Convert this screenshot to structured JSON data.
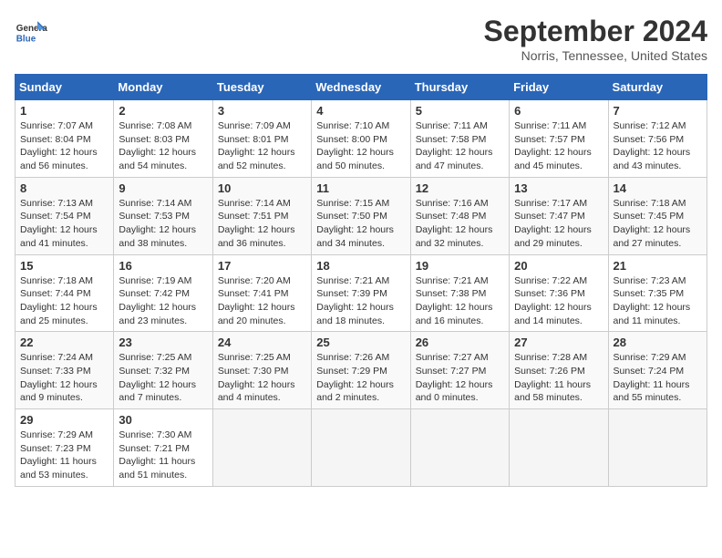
{
  "header": {
    "logo_line1": "General",
    "logo_line2": "Blue",
    "title": "September 2024",
    "subtitle": "Norris, Tennessee, United States"
  },
  "days_of_week": [
    "Sunday",
    "Monday",
    "Tuesday",
    "Wednesday",
    "Thursday",
    "Friday",
    "Saturday"
  ],
  "weeks": [
    [
      {
        "day": 1,
        "sunrise": "7:07 AM",
        "sunset": "8:04 PM",
        "daylight": "12 hours and 56 minutes."
      },
      {
        "day": 2,
        "sunrise": "7:08 AM",
        "sunset": "8:03 PM",
        "daylight": "12 hours and 54 minutes."
      },
      {
        "day": 3,
        "sunrise": "7:09 AM",
        "sunset": "8:01 PM",
        "daylight": "12 hours and 52 minutes."
      },
      {
        "day": 4,
        "sunrise": "7:10 AM",
        "sunset": "8:00 PM",
        "daylight": "12 hours and 50 minutes."
      },
      {
        "day": 5,
        "sunrise": "7:11 AM",
        "sunset": "7:58 PM",
        "daylight": "12 hours and 47 minutes."
      },
      {
        "day": 6,
        "sunrise": "7:11 AM",
        "sunset": "7:57 PM",
        "daylight": "12 hours and 45 minutes."
      },
      {
        "day": 7,
        "sunrise": "7:12 AM",
        "sunset": "7:56 PM",
        "daylight": "12 hours and 43 minutes."
      }
    ],
    [
      {
        "day": 8,
        "sunrise": "7:13 AM",
        "sunset": "7:54 PM",
        "daylight": "12 hours and 41 minutes."
      },
      {
        "day": 9,
        "sunrise": "7:14 AM",
        "sunset": "7:53 PM",
        "daylight": "12 hours and 38 minutes."
      },
      {
        "day": 10,
        "sunrise": "7:14 AM",
        "sunset": "7:51 PM",
        "daylight": "12 hours and 36 minutes."
      },
      {
        "day": 11,
        "sunrise": "7:15 AM",
        "sunset": "7:50 PM",
        "daylight": "12 hours and 34 minutes."
      },
      {
        "day": 12,
        "sunrise": "7:16 AM",
        "sunset": "7:48 PM",
        "daylight": "12 hours and 32 minutes."
      },
      {
        "day": 13,
        "sunrise": "7:17 AM",
        "sunset": "7:47 PM",
        "daylight": "12 hours and 29 minutes."
      },
      {
        "day": 14,
        "sunrise": "7:18 AM",
        "sunset": "7:45 PM",
        "daylight": "12 hours and 27 minutes."
      }
    ],
    [
      {
        "day": 15,
        "sunrise": "7:18 AM",
        "sunset": "7:44 PM",
        "daylight": "12 hours and 25 minutes."
      },
      {
        "day": 16,
        "sunrise": "7:19 AM",
        "sunset": "7:42 PM",
        "daylight": "12 hours and 23 minutes."
      },
      {
        "day": 17,
        "sunrise": "7:20 AM",
        "sunset": "7:41 PM",
        "daylight": "12 hours and 20 minutes."
      },
      {
        "day": 18,
        "sunrise": "7:21 AM",
        "sunset": "7:39 PM",
        "daylight": "12 hours and 18 minutes."
      },
      {
        "day": 19,
        "sunrise": "7:21 AM",
        "sunset": "7:38 PM",
        "daylight": "12 hours and 16 minutes."
      },
      {
        "day": 20,
        "sunrise": "7:22 AM",
        "sunset": "7:36 PM",
        "daylight": "12 hours and 14 minutes."
      },
      {
        "day": 21,
        "sunrise": "7:23 AM",
        "sunset": "7:35 PM",
        "daylight": "12 hours and 11 minutes."
      }
    ],
    [
      {
        "day": 22,
        "sunrise": "7:24 AM",
        "sunset": "7:33 PM",
        "daylight": "12 hours and 9 minutes."
      },
      {
        "day": 23,
        "sunrise": "7:25 AM",
        "sunset": "7:32 PM",
        "daylight": "12 hours and 7 minutes."
      },
      {
        "day": 24,
        "sunrise": "7:25 AM",
        "sunset": "7:30 PM",
        "daylight": "12 hours and 4 minutes."
      },
      {
        "day": 25,
        "sunrise": "7:26 AM",
        "sunset": "7:29 PM",
        "daylight": "12 hours and 2 minutes."
      },
      {
        "day": 26,
        "sunrise": "7:27 AM",
        "sunset": "7:27 PM",
        "daylight": "12 hours and 0 minutes."
      },
      {
        "day": 27,
        "sunrise": "7:28 AM",
        "sunset": "7:26 PM",
        "daylight": "11 hours and 58 minutes."
      },
      {
        "day": 28,
        "sunrise": "7:29 AM",
        "sunset": "7:24 PM",
        "daylight": "11 hours and 55 minutes."
      }
    ],
    [
      {
        "day": 29,
        "sunrise": "7:29 AM",
        "sunset": "7:23 PM",
        "daylight": "11 hours and 53 minutes."
      },
      {
        "day": 30,
        "sunrise": "7:30 AM",
        "sunset": "7:21 PM",
        "daylight": "11 hours and 51 minutes."
      },
      null,
      null,
      null,
      null,
      null
    ]
  ]
}
